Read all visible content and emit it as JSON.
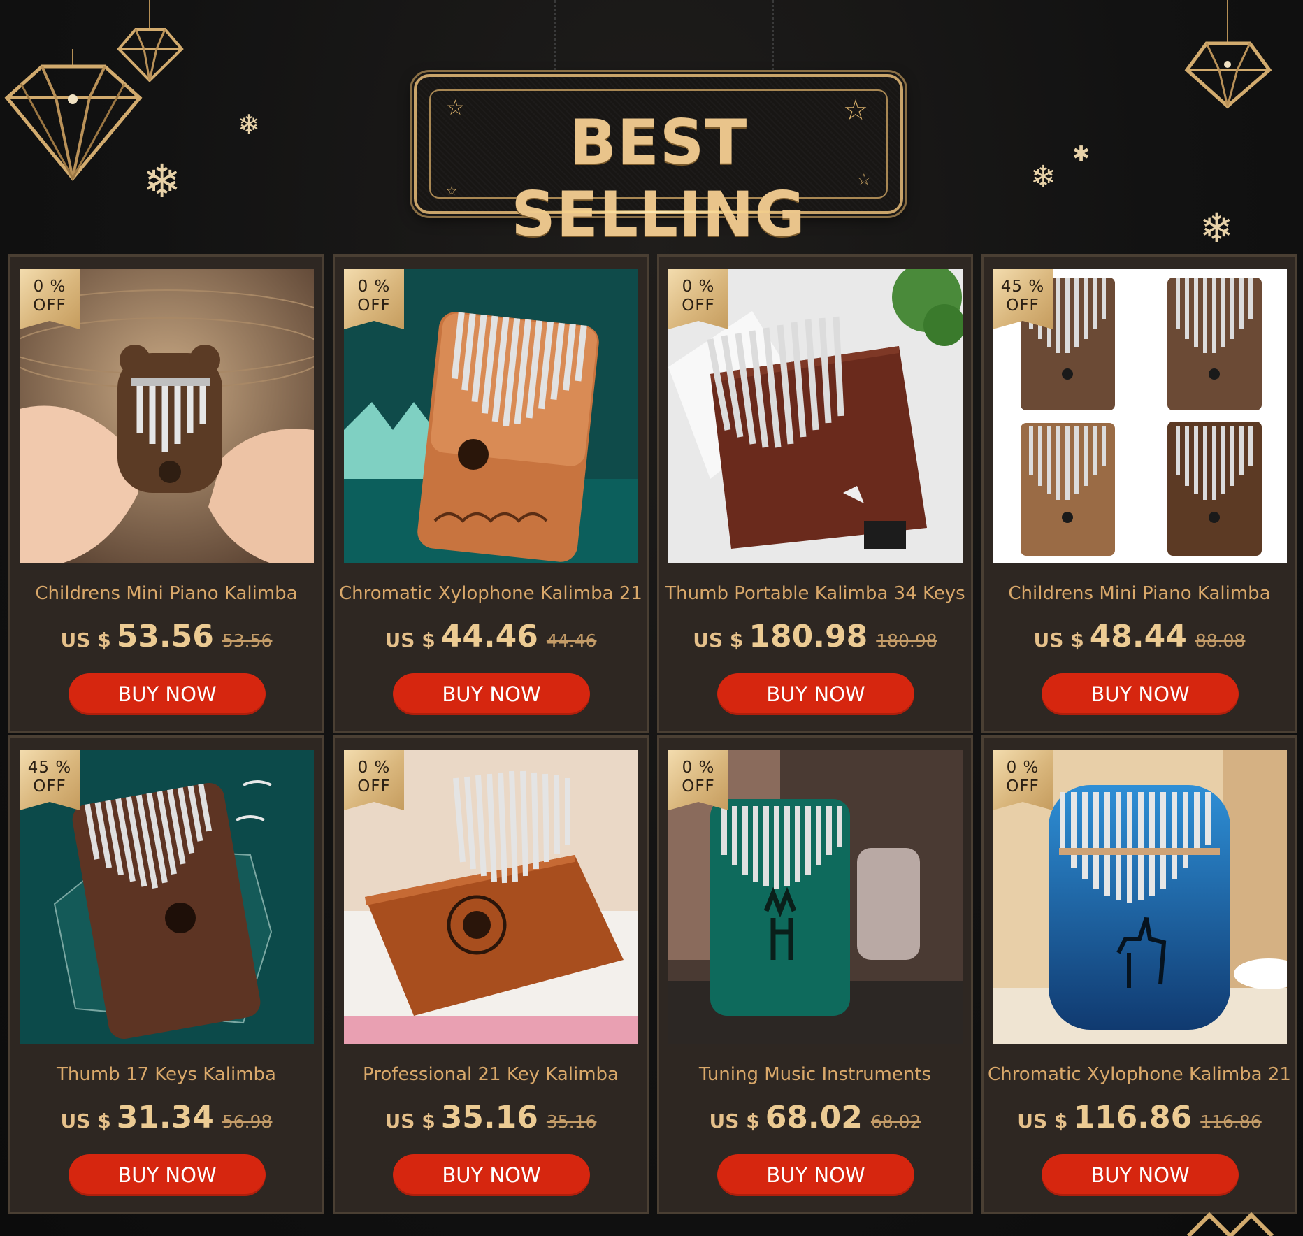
{
  "banner": {
    "title": "BEST SELLING"
  },
  "buy_label": "BUY NOW",
  "currency": "US $",
  "colors": {
    "accent_gold": "#e9c48b",
    "button_red": "#d6260f",
    "card_bg": "#2e2722"
  },
  "products": [
    {
      "badge_pct": "0 %",
      "badge_off": "OFF",
      "name": "Childrens Mini Piano Kalimba",
      "price": "53.56",
      "old_price": "53.56",
      "image": "hands-holding-mini-kalimba"
    },
    {
      "badge_pct": "0 %",
      "badge_off": "OFF",
      "name": "Chromatic Xylophone Kalimba 21",
      "price": "44.46",
      "old_price": "44.46",
      "image": "orange-engraved-kalimba-teal"
    },
    {
      "badge_pct": "0 %",
      "badge_off": "OFF",
      "name": "Thumb Portable Kalimba 34 Keys",
      "price": "180.98",
      "old_price": "180.98",
      "image": "mahogany-kalimba-on-stand"
    },
    {
      "badge_pct": "45 %",
      "badge_off": "OFF",
      "name": "Childrens Mini Piano Kalimba",
      "price": "48.44",
      "old_price": "88.08",
      "image": "four-seeds-kalimbas"
    },
    {
      "badge_pct": "45 %",
      "badge_off": "OFF",
      "name": "Thumb 17 Keys Kalimba",
      "price": "31.34",
      "old_price": "56.98",
      "image": "brown-kalimba-cranes"
    },
    {
      "badge_pct": "0 %",
      "badge_off": "OFF",
      "name": "Professional 21 Key Kalimba",
      "price": "35.16",
      "old_price": "35.16",
      "image": "orange-kalimba-floral"
    },
    {
      "badge_pct": "0 %",
      "badge_off": "OFF",
      "name": "Tuning Music Instruments",
      "price": "68.02",
      "old_price": "68.02",
      "image": "green-kalimba-deer"
    },
    {
      "badge_pct": "0 %",
      "badge_off": "OFF",
      "name": "Chromatic Xylophone Kalimba 21",
      "price": "116.86",
      "old_price": "116.86",
      "image": "blue-kalimba-deer"
    }
  ]
}
